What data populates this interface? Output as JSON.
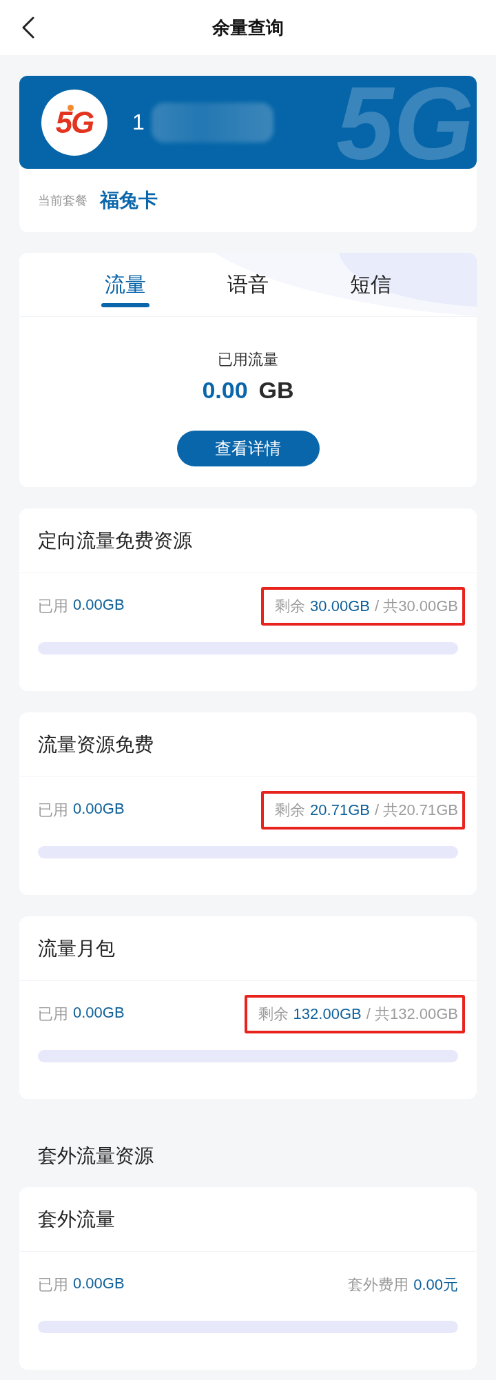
{
  "header": {
    "title": "余量查询"
  },
  "account": {
    "logo": "5G",
    "background_mark": "5G",
    "number": "1",
    "plan_label": "当前套餐",
    "plan_name": "福兔卡"
  },
  "usage_tabs": [
    {
      "label": "流量",
      "selected": true
    },
    {
      "label": "语音",
      "selected": false
    },
    {
      "label": "短信",
      "selected": false
    }
  ],
  "usage_summary": {
    "label": "已用流量",
    "value": "0.00",
    "unit": "GB",
    "button": "查看详情"
  },
  "resources": [
    {
      "title": "定向流量免费资源",
      "used_label": "已用",
      "used_value": "0.00GB",
      "right_label": "剩余",
      "right_value": "30.00GB",
      "total": "/ 共30.00GB",
      "highlighted": true,
      "level": 0
    },
    {
      "title": "流量资源免费",
      "used_label": "已用",
      "used_value": "0.00GB",
      "right_label": "剩余",
      "right_value": "20.71GB",
      "total": "/ 共20.71GB",
      "highlighted": true,
      "level": 0
    },
    {
      "title": "流量月包",
      "used_label": "已用",
      "used_value": "0.00GB",
      "right_label": "剩余",
      "right_value": "132.00GB",
      "total": "/ 共132.00GB",
      "highlighted": true,
      "level": 0
    }
  ],
  "extra_section": {
    "heading": "套外流量资源",
    "resources": [
      {
        "title": "套外流量",
        "used_label": "已用",
        "used_value": "0.00GB",
        "right_label": "套外费用",
        "right_value": "0.00元",
        "highlighted": false,
        "level": 0
      }
    ]
  }
}
